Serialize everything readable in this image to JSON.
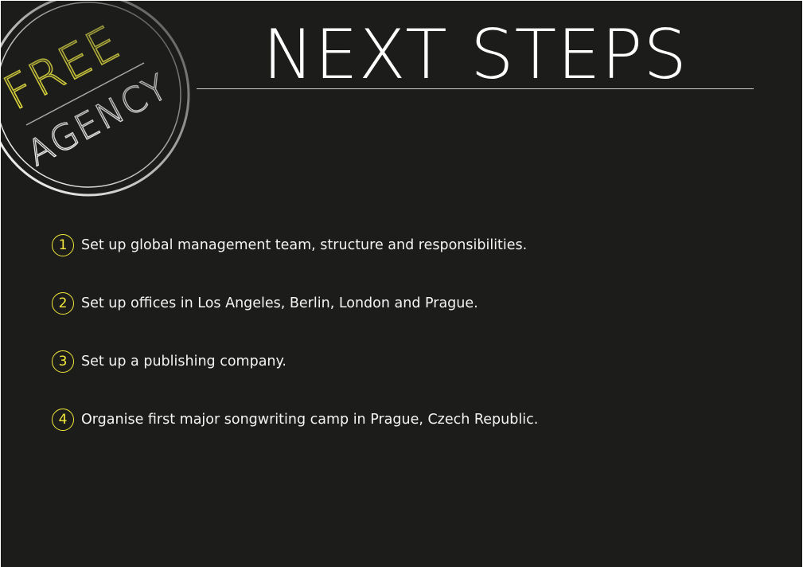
{
  "logo": {
    "line1": "FREE",
    "line2": "AGENCY",
    "accent_color": "#f2e93a"
  },
  "title": "NEXT STEPS",
  "steps": [
    {
      "number": "1",
      "text": "Set up global management team, structure and responsibilities."
    },
    {
      "number": "2",
      "text": "Set up offices in Los Angeles, Berlin, London and Prague."
    },
    {
      "number": "3",
      "text": "Set up a publishing company."
    },
    {
      "number": "4",
      "text": "Organise first major songwriting camp in Prague, Czech Republic."
    }
  ],
  "colors": {
    "background": "#1c1c1b",
    "text": "#f4f4f4",
    "accent": "#f2e93a"
  }
}
